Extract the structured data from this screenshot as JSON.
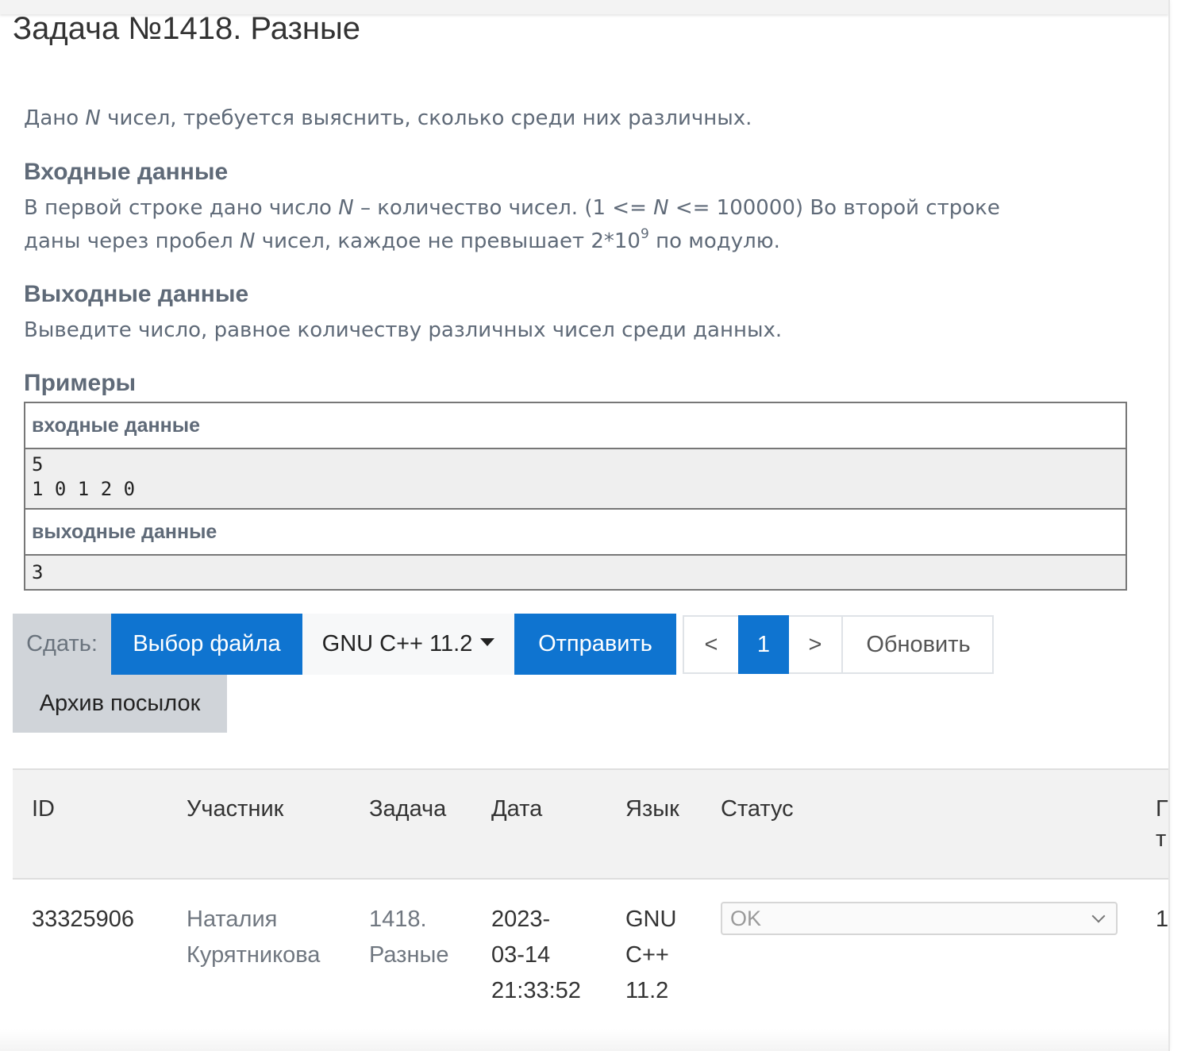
{
  "problem": {
    "title": "Задача №1418. Разные",
    "statement_pre": "Дано ",
    "statement_var": "N",
    "statement_post": " чисел, требуется выяснить, сколько среди них различных.",
    "input_title": "Входные данные",
    "input_p1": "В первой строке дано число ",
    "input_v1": "N",
    "input_p2": " – количество чисел. (1 <= ",
    "input_v2": "N",
    "input_p3": " <= 100000) Во второй строке",
    "input_p4": "даны через пробел ",
    "input_v3": "N",
    "input_p5": " чисел, каждое не превышает 2*10",
    "input_sup": "9",
    "input_p6": " по модулю.",
    "output_title": "Выходные данные",
    "output_text": "Выведите число, равное количеству различных чисел среди данных.",
    "examples_title": "Примеры",
    "examples": {
      "input_header": "входные данные",
      "input_line1": "5",
      "input_line2": "1 0 1 2 0",
      "output_header": "выходные данные",
      "output_line1": "3"
    }
  },
  "submit": {
    "label": "Сдать:",
    "file_button": "Выбор файла",
    "language": "GNU C++ 11.2",
    "send_button": "Отправить",
    "archive_button": "Архив посылок"
  },
  "pagination": {
    "prev": "<",
    "current": "1",
    "next": ">",
    "refresh": "Обновить"
  },
  "submissions": {
    "headers": {
      "id": "ID",
      "participant": "Участник",
      "task": "Задача",
      "date": "Дата",
      "language": "Язык",
      "status": "Статус",
      "extra_line1": "Г",
      "extra_line2": "т"
    },
    "rows": [
      {
        "id": "33325906",
        "participant_line1": "Наталия",
        "participant_line2": "Курятникова",
        "task_line1": "1418.",
        "task_line2": "Разные",
        "date_line1": "2023-",
        "date_line2": "03-14",
        "date_line3": "21:33:52",
        "lang_line1": "GNU",
        "lang_line2": "C++",
        "lang_line3": "11.2",
        "status": "OK",
        "extra": "1"
      }
    ]
  },
  "colors": {
    "primary": "#0f74d0",
    "muted_text": "#5f6a78",
    "label_bg": "#d0d4d9"
  }
}
